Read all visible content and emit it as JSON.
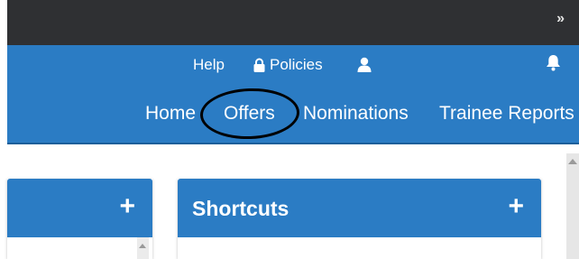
{
  "topbar": {
    "expand_icon": "»"
  },
  "header": {
    "utility": {
      "help": "Help",
      "policies": "Policies"
    },
    "nav": {
      "home": "Home",
      "offers": "Offers",
      "nominations": "Nominations",
      "trainee_reports": "Trainee Reports"
    }
  },
  "panels": {
    "left": {
      "title": "",
      "add": "+"
    },
    "shortcuts": {
      "title": "Shortcuts",
      "add": "+"
    }
  },
  "icons": {
    "lock": "lock-icon",
    "user": "user-icon",
    "bell": "bell-icon",
    "expand": "double-chevron-right-icon",
    "plus": "plus-icon"
  },
  "colors": {
    "topbar": "#2f3033",
    "header": "#2b7cc4",
    "text": "#ffffff"
  }
}
